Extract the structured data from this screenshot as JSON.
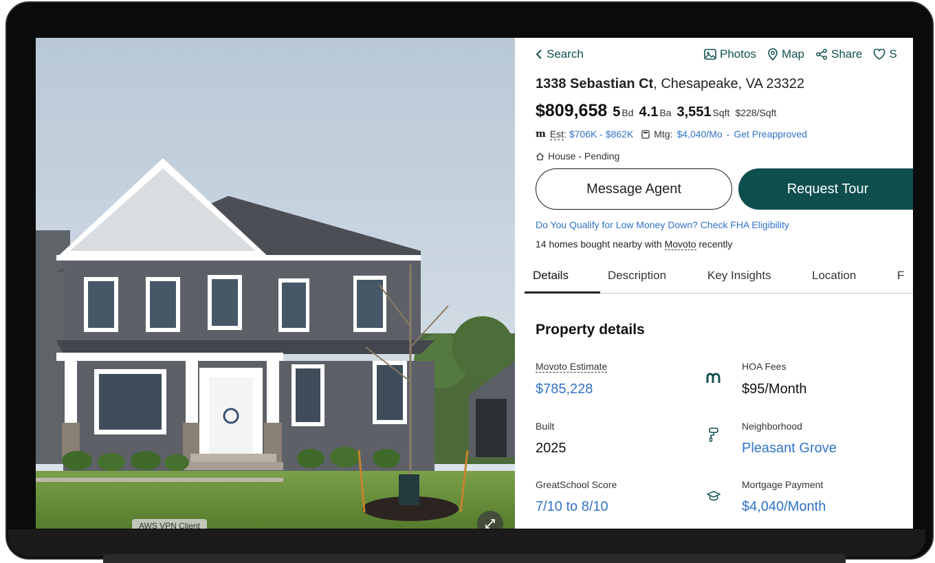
{
  "header": {
    "back_label": "Search",
    "actions": [
      {
        "label": "Photos",
        "icon": "image-icon"
      },
      {
        "label": "Map",
        "icon": "map-pin-icon"
      },
      {
        "label": "Share",
        "icon": "share-icon"
      },
      {
        "label": "S",
        "icon": "heart-icon"
      }
    ]
  },
  "listing": {
    "address_street": "1338 Sebastian Ct",
    "address_rest": ", Chesapeake, VA 23322",
    "price": "$809,658",
    "beds": "5",
    "beds_unit": "Bd",
    "baths": "4.1",
    "baths_unit": "Ba",
    "sqft": "3,551",
    "sqft_unit": "Sqft",
    "price_per_sqft": "$228/Sqft",
    "est_label": "Est",
    "est_range": "$706K - $862K",
    "mtg_label": "Mtg:",
    "mtg_value": "$4,040/Mo",
    "preapproved": "Get Preapproved",
    "type_status": "House - Pending"
  },
  "buttons": {
    "message_agent": "Message Agent",
    "request_tour": "Request Tour"
  },
  "links": {
    "fha": "Do You Qualify for Low Money Down? Check FHA Eligibility",
    "nearby_pre": "14 homes bought nearby with ",
    "nearby_brand": "Movoto",
    "nearby_post": " recently"
  },
  "tabs": [
    {
      "label": "Details",
      "active": true
    },
    {
      "label": "Description"
    },
    {
      "label": "Key Insights"
    },
    {
      "label": "Location"
    },
    {
      "label": "F"
    }
  ],
  "property_details": {
    "title": "Property details",
    "facts": [
      {
        "label": "Movoto Estimate",
        "value": "$785,228"
      },
      {
        "label": "HOA Fees",
        "value": "$95/Month"
      },
      {
        "label": "Built",
        "value": "2025"
      },
      {
        "label": "Neighborhood",
        "value": "Pleasant Grove"
      },
      {
        "label": "GreatSchool Score",
        "value": "7/10 to 8/10"
      },
      {
        "label": "Mortgage Payment",
        "value": "$4,040/Month"
      }
    ]
  },
  "overlay": {
    "vpn_label": "AWS VPN Client"
  },
  "colors": {
    "brand": "#0e4f4e",
    "link": "#2f72c7"
  }
}
